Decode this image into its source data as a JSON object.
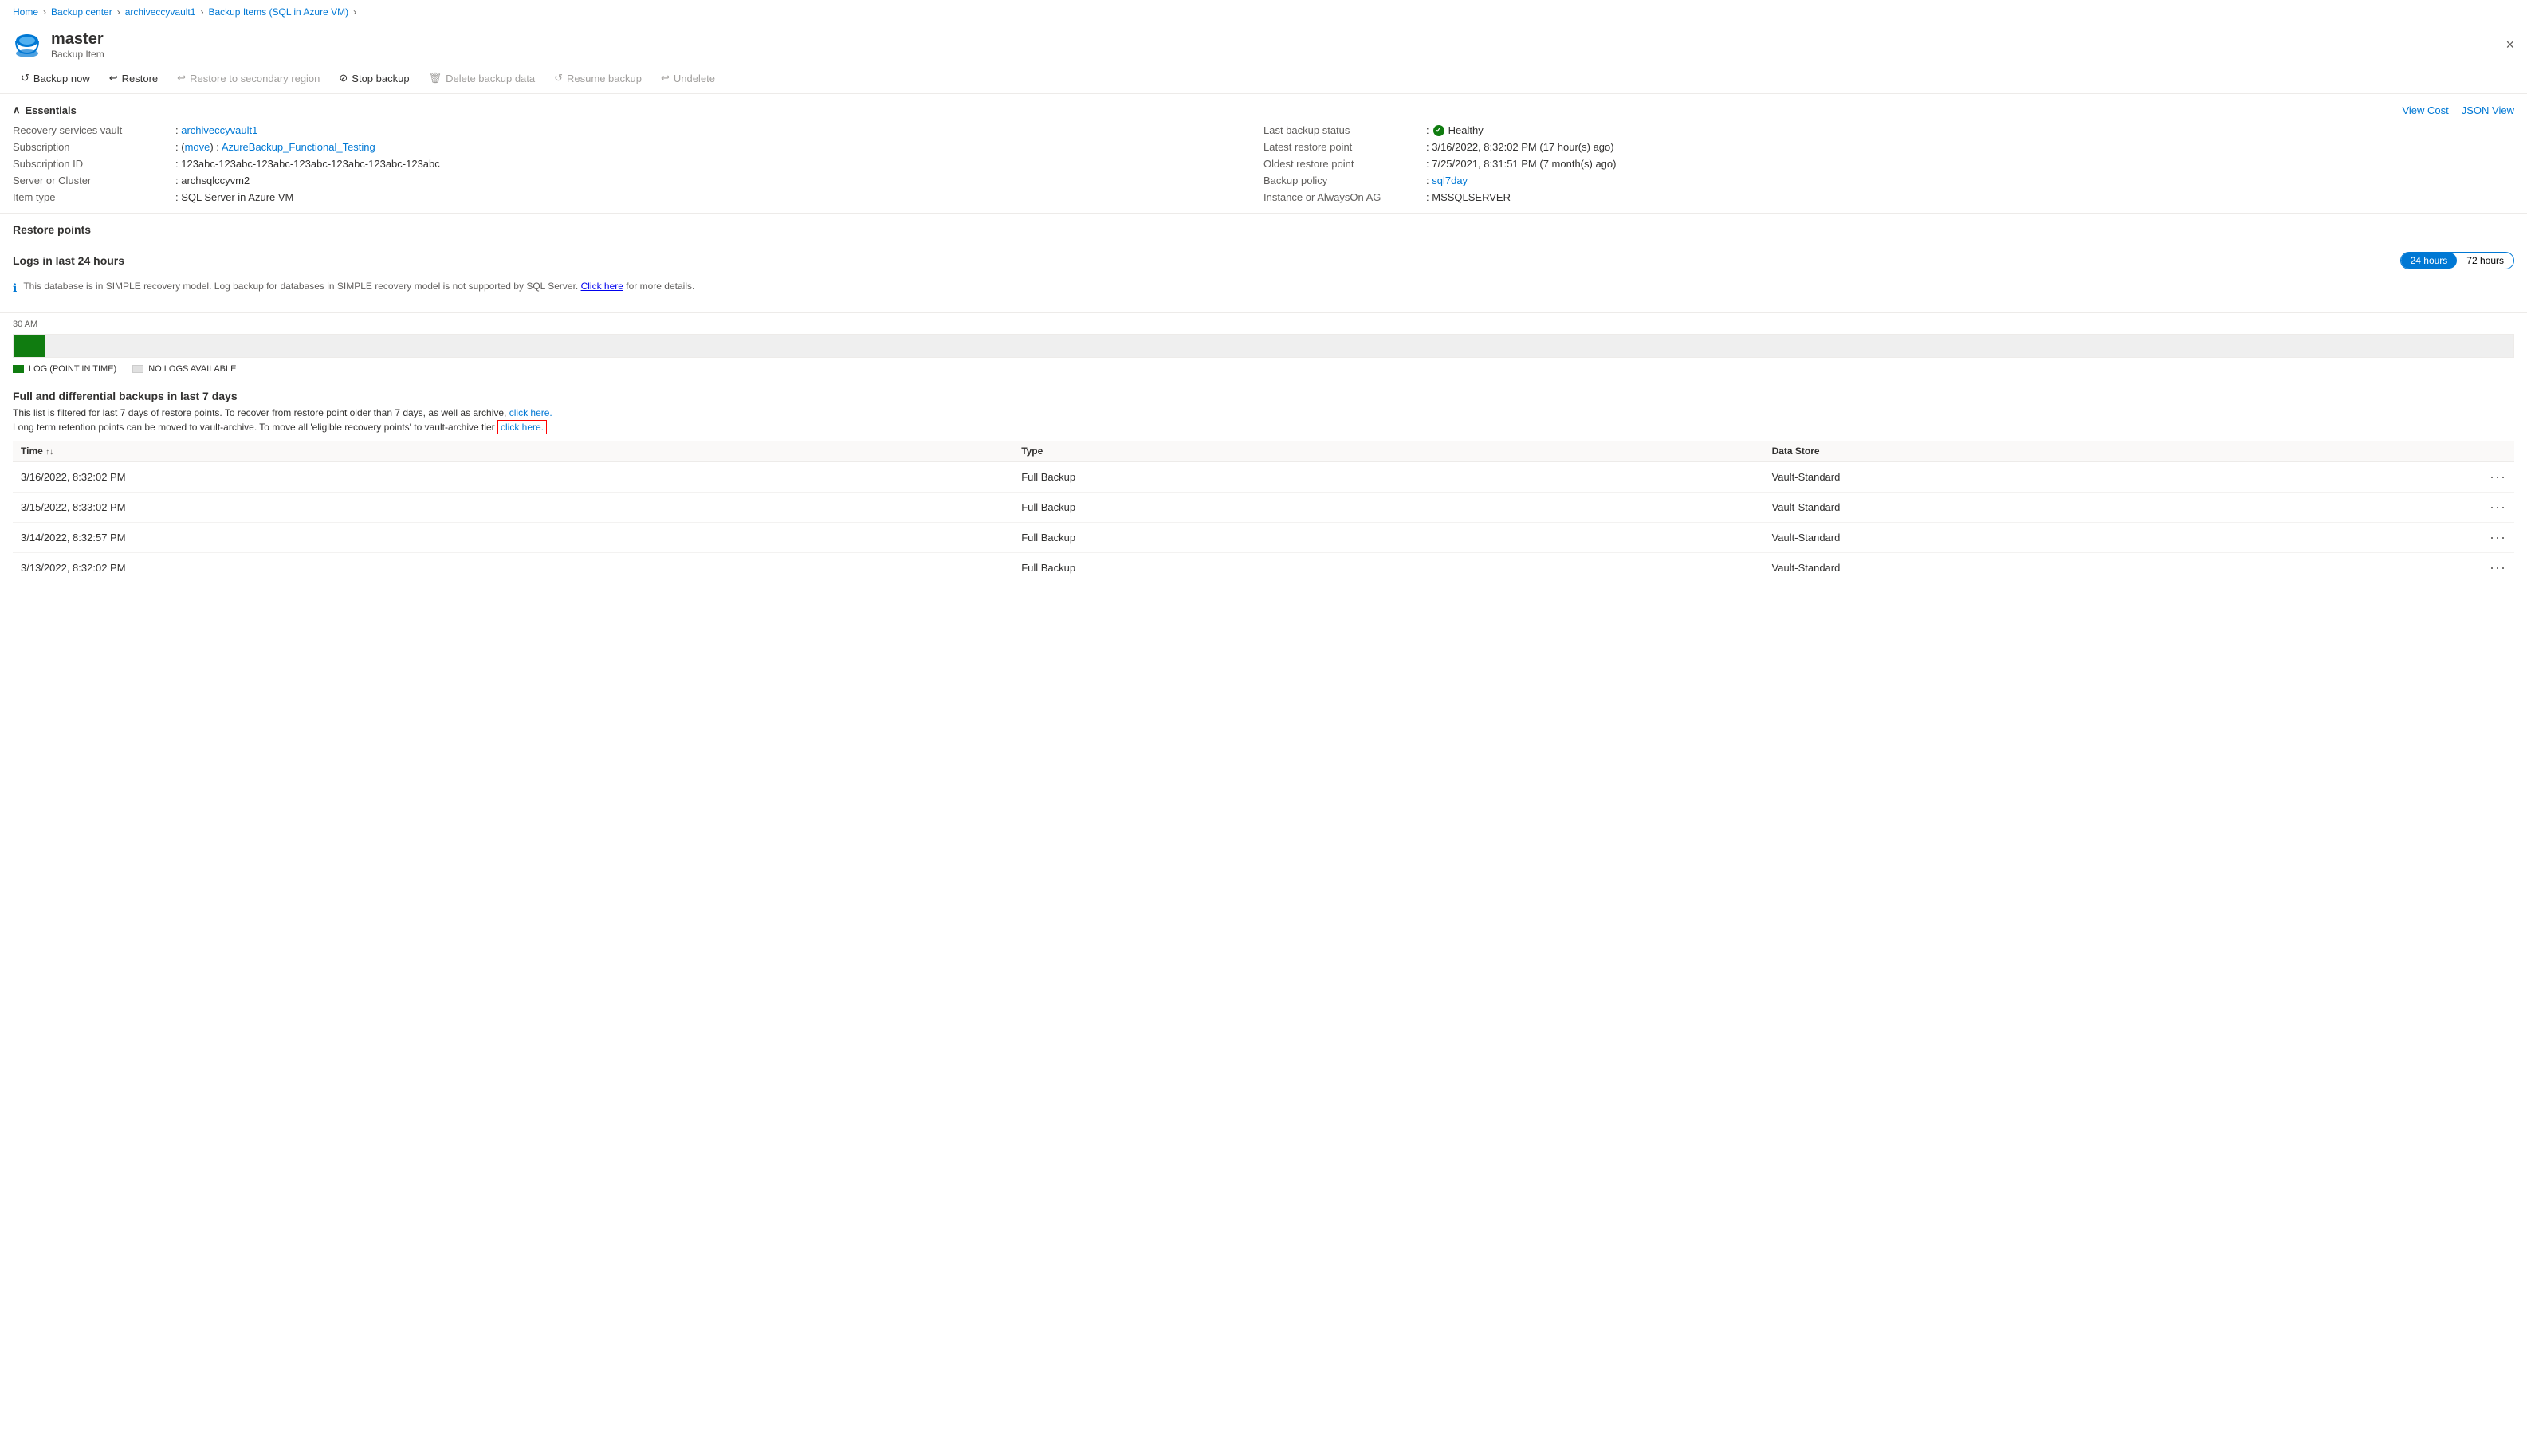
{
  "breadcrumb": {
    "items": [
      "Home",
      "Backup center",
      "archiveccyvault1",
      "Backup Items (SQL in Azure VM)"
    ]
  },
  "header": {
    "title": "master",
    "subtitle": "Backup Item",
    "close_label": "×"
  },
  "toolbar": {
    "buttons": [
      {
        "id": "backup-now",
        "label": "Backup now",
        "icon": "↺",
        "disabled": false
      },
      {
        "id": "restore",
        "label": "Restore",
        "icon": "↩",
        "disabled": false
      },
      {
        "id": "restore-secondary",
        "label": "Restore to secondary region",
        "icon": "↩",
        "disabled": true
      },
      {
        "id": "stop-backup",
        "label": "Stop backup",
        "icon": "⊘",
        "disabled": false
      },
      {
        "id": "delete-backup",
        "label": "Delete backup data",
        "icon": "🗑",
        "disabled": true
      },
      {
        "id": "resume-backup",
        "label": "Resume backup",
        "icon": "↺",
        "disabled": true
      },
      {
        "id": "undelete",
        "label": "Undelete",
        "icon": "↩",
        "disabled": true
      }
    ]
  },
  "essentials": {
    "title": "Essentials",
    "view_cost_label": "View Cost",
    "json_view_label": "JSON View",
    "left": [
      {
        "label": "Recovery services vault",
        "value": "archiveccyvault1",
        "link": true
      },
      {
        "label": "Subscription",
        "value": "AzureBackup_Functional_Testing",
        "prefix": "(move)",
        "link": true
      },
      {
        "label": "Subscription ID",
        "value": "123abc-123abc-123abc-123abc-123abc-123abc-123abc"
      },
      {
        "label": "Server or Cluster",
        "value": "archsqlccyvm2"
      },
      {
        "label": "Item type",
        "value": "SQL Server in Azure VM"
      }
    ],
    "right": [
      {
        "label": "Last backup status",
        "value": "Healthy",
        "status": true
      },
      {
        "label": "Latest restore point",
        "value": ": 3/16/2022, 8:32:02 PM (17 hour(s) ago)"
      },
      {
        "label": "Oldest restore point",
        "value": ": 7/25/2021, 8:31:51 PM (7 month(s) ago)"
      },
      {
        "label": "Backup policy",
        "value": "sql7day",
        "link": true
      },
      {
        "label": "Instance or AlwaysOn AG",
        "value": "MSSQLSERVER"
      }
    ]
  },
  "restore_points": {
    "title": "Restore points"
  },
  "logs": {
    "title": "Logs in last 24 hours",
    "time_options": [
      "24 hours",
      "72 hours"
    ],
    "active_time": "24 hours",
    "info_text": "This database is in SIMPLE recovery model. Log backup for databases in SIMPLE recovery model is not supported by SQL Server.",
    "info_link_text": "Click here",
    "info_suffix": " for more details.",
    "timeline_label": "30 AM",
    "legend": [
      {
        "label": "LOG (POINT IN TIME)",
        "color": "green"
      },
      {
        "label": "NO LOGS AVAILABLE",
        "color": "gray"
      }
    ]
  },
  "full_diff": {
    "title": "Full and differential backups in last 7 days",
    "filter_text": "This list is filtered for last 7 days of restore points. To recover from restore point older than 7 days, as well as archive,",
    "filter_link": "click here.",
    "retention_text": "Long term retention points can be moved to vault-archive. To move all 'eligible recovery points' to vault-archive tier",
    "retention_link": "click here.",
    "columns": [
      {
        "label": "Time",
        "sort": true
      },
      {
        "label": "Type",
        "sort": false
      },
      {
        "label": "Data Store",
        "sort": false
      },
      {
        "label": "",
        "sort": false
      }
    ],
    "rows": [
      {
        "time": "3/16/2022, 8:32:02 PM",
        "type": "Full Backup",
        "store": "Vault-Standard"
      },
      {
        "time": "3/15/2022, 8:33:02 PM",
        "type": "Full Backup",
        "store": "Vault-Standard"
      },
      {
        "time": "3/14/2022, 8:32:57 PM",
        "type": "Full Backup",
        "store": "Vault-Standard"
      },
      {
        "time": "3/13/2022, 8:32:02 PM",
        "type": "Full Backup",
        "store": "Vault-Standard"
      }
    ]
  }
}
